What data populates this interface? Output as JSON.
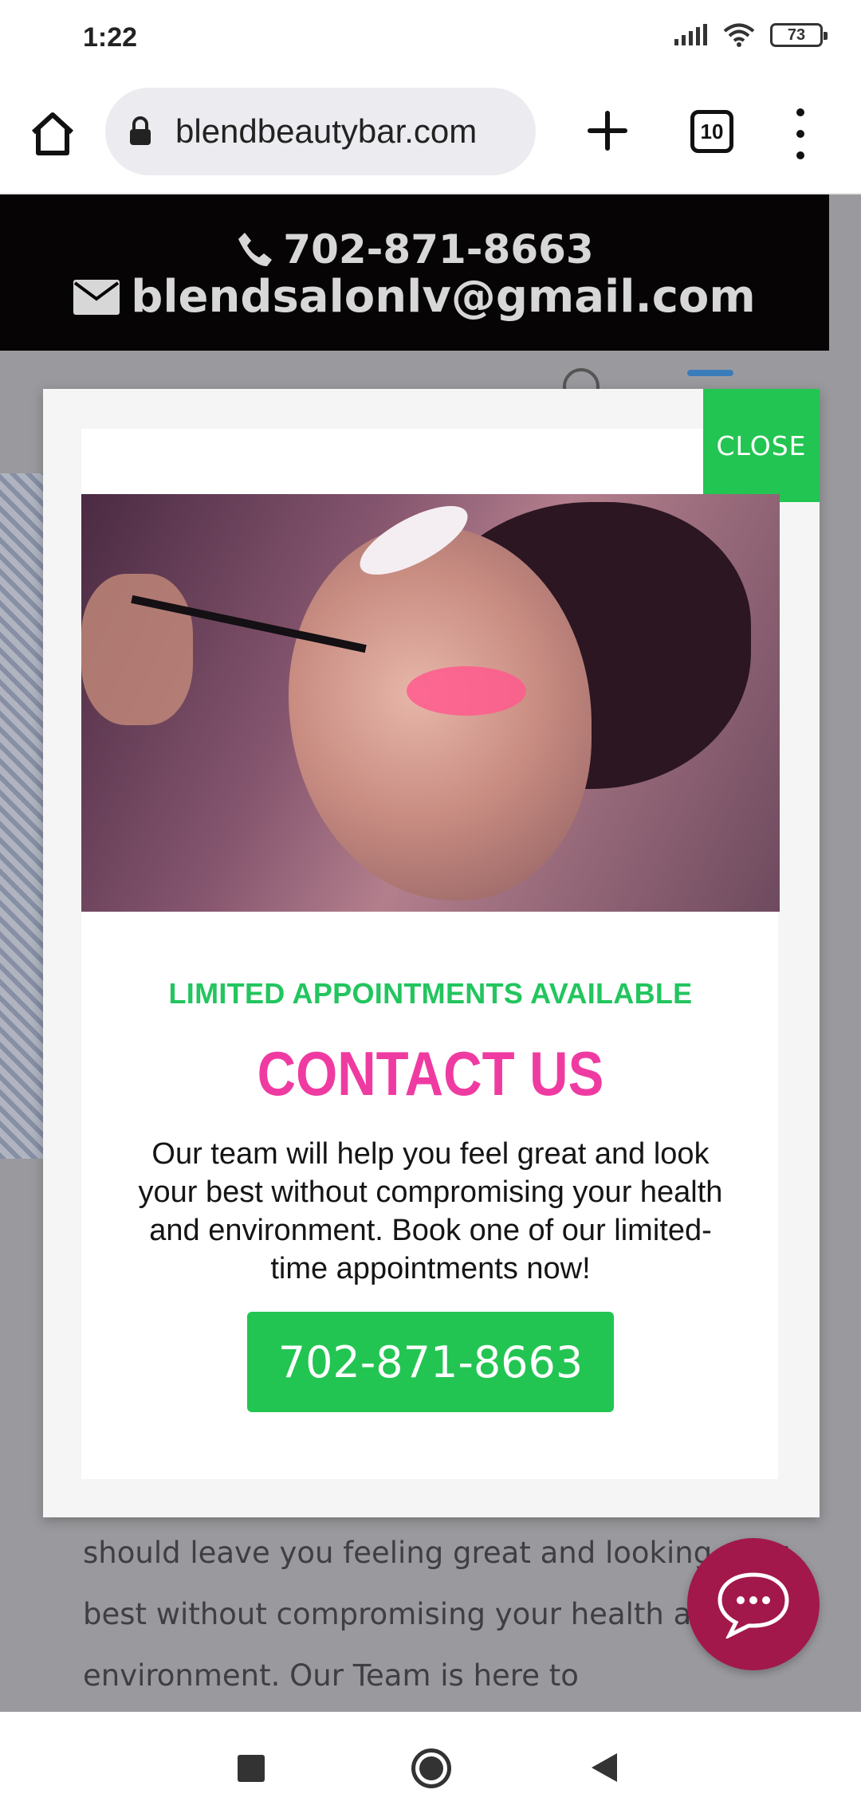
{
  "status_bar": {
    "time": "1:22",
    "battery": "73"
  },
  "browser": {
    "url": "blendbeautybar.com",
    "tab_count": "10"
  },
  "site_banner": {
    "phone": "702-871-8663",
    "email": "blendsalonlv@gmail.com"
  },
  "popup": {
    "close_label": "CLOSE",
    "kicker": "LIMITED APPOINTMENTS AVAILABLE",
    "title": "CONTACT US",
    "body": "Our team will help you feel great and look your best without compromising your health and environment. Book one of our limited-time appointments now!",
    "phone_button": "702-871-8663"
  },
  "page": {
    "body_text": "should leave you feeling great and looking your best without compromising your health and the environment. Our Team is here to"
  },
  "colors": {
    "accent_green": "#23c552",
    "accent_pink": "#ef3ba1",
    "chat_button": "#a2184b"
  }
}
